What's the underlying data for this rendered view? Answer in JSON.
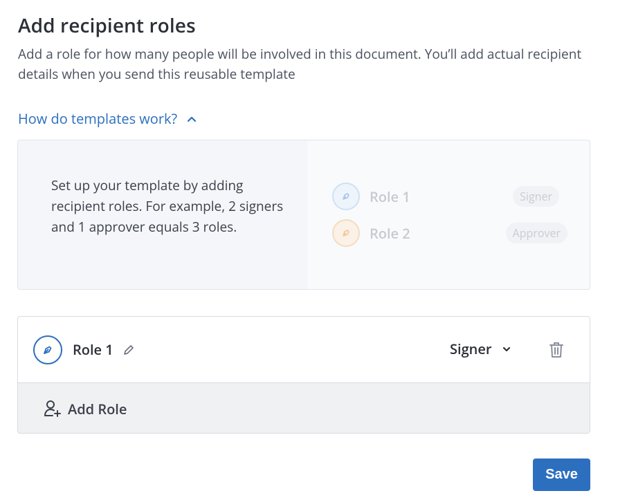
{
  "header": {
    "title": "Add recipient roles",
    "description": "Add a role for how many people will be involved in this document. You’ll add actual recipient details when you send this reusable template"
  },
  "howto": {
    "label": "How do templates work?",
    "icon": "chevron-up-icon",
    "expanded": true
  },
  "info": {
    "text": "Set up your template by adding recipient roles. For example, 2 signers and 1 approver equals 3 roles.",
    "examples": [
      {
        "name": "Role 1",
        "type": "Signer",
        "color": "#cfe0f4"
      },
      {
        "name": "Role 2",
        "type": "Approver",
        "color": "#f4dcc0"
      }
    ]
  },
  "roles": [
    {
      "name": "Role 1",
      "type": "Signer",
      "icon": "pen-nib-icon"
    }
  ],
  "actions": {
    "add_role": "Add Role",
    "save": "Save"
  },
  "colors": {
    "accent": "#2c6fbf",
    "text": "#2b2f36"
  }
}
